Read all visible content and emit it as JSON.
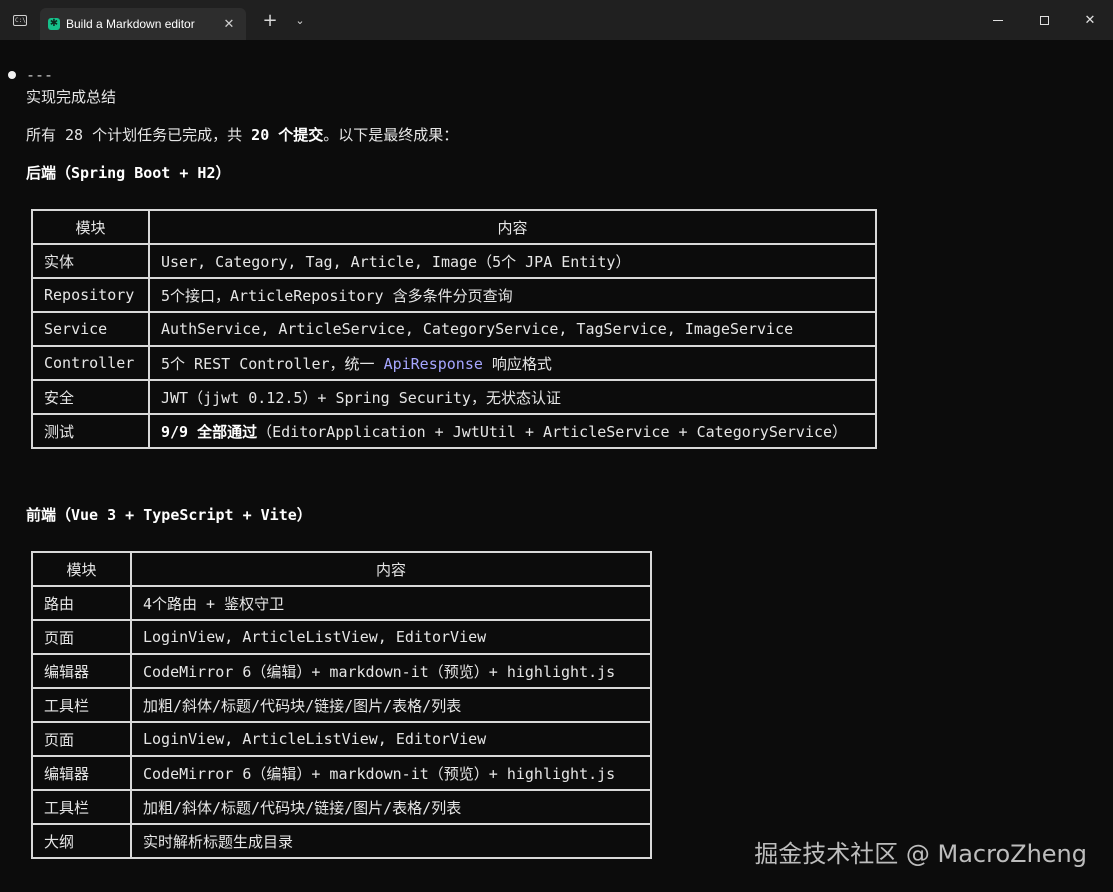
{
  "window": {
    "tab_title": "Build a Markdown editor",
    "tab_icon": "sparkle-icon",
    "terminal_icon_text": "C:\\",
    "close_tab_glyph": "✕",
    "new_tab_glyph": "+",
    "dropdown_glyph": "⌄",
    "maximize_glyph": "",
    "close_glyph": "✕"
  },
  "output": {
    "rule": "---",
    "heading": "实现完成总结",
    "summary": {
      "prefix": "所有 ",
      "tasks": "28",
      "middle": " 个计划任务已完成，共 ",
      "commits": "20 个提交",
      "suffix": "。以下是最终成果："
    },
    "backend_title": "后端（Spring Boot + H2）",
    "backend_table": {
      "headers": [
        "模块",
        "内容"
      ],
      "rows": [
        {
          "module": "实体",
          "content": "User, Category, Tag, Article, Image（5个 JPA Entity）"
        },
        {
          "module": "Repository",
          "content": "5个接口，ArticleRepository 含多条件分页查询"
        },
        {
          "module": "Service",
          "content": "AuthService, ArticleService, CategoryService, TagService, ImageService"
        },
        {
          "module": "Controller",
          "content_prefix": "5个 REST Controller，统一 ",
          "content_code": "ApiResponse",
          "content_suffix": " 响应格式"
        },
        {
          "module": "安全",
          "content": "JWT（jjwt 0.12.5）+ Spring Security，无状态认证"
        },
        {
          "module": "测试",
          "content_bold": "9/9 全部通过",
          "content_suffix": "（EditorApplication + JwtUtil + ArticleService + CategoryService）"
        }
      ]
    },
    "frontend_title": "前端（Vue 3 + TypeScript + Vite）",
    "frontend_table": {
      "headers": [
        "模块",
        "内容"
      ],
      "rows": [
        {
          "module": "路由",
          "content": "4个路由 + 鉴权守卫"
        },
        {
          "module": "页面",
          "content": "LoginView, ArticleListView, EditorView"
        },
        {
          "module": "编辑器",
          "content": "CodeMirror 6（编辑）+ markdown-it（预览）+ highlight.js"
        },
        {
          "module": "工具栏",
          "content": "加粗/斜体/标题/代码块/链接/图片/表格/列表"
        },
        {
          "module": "页面",
          "content": "LoginView, ArticleListView, EditorView"
        },
        {
          "module": "编辑器",
          "content": "CodeMirror 6（编辑）+ markdown-it（预览）+ highlight.js"
        },
        {
          "module": "工具栏",
          "content": "加粗/斜体/标题/代码块/链接/图片/表格/列表"
        },
        {
          "module": "大纲",
          "content": "实时解析标题生成目录"
        }
      ]
    }
  },
  "watermark": "掘金技术社区 @ MacroZheng",
  "colors": {
    "background": "#0c0c0c",
    "titlebar": "#202020",
    "tab": "#2d2d2d",
    "text": "#e6e6e6",
    "code_highlight": "#a6a6ff",
    "tab_icon": "#16c08a"
  }
}
